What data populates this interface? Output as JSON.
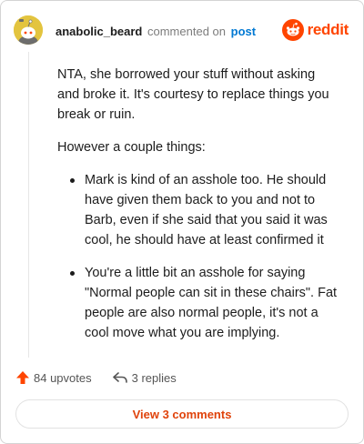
{
  "comment": {
    "username": "anabolic_beard",
    "action_text": "commented on",
    "link_text": "post",
    "paragraphs": [
      "NTA, she borrowed your stuff without asking and broke it. It's courtesy to replace things you break or ruin.",
      "However a couple things:"
    ],
    "bullets": [
      "Mark is kind of an asshole too. He should have given them back to you and not to Barb, even if she said that you said it was cool, he should have at least confirmed it",
      "You're a little bit an asshole for saying \"Normal people can sit in these chairs\". Fat people are also normal people, it's not a cool move what you are implying."
    ]
  },
  "brand": {
    "logo_text": "reddit",
    "accent_color": "#ff4500",
    "link_color": "#0079d3"
  },
  "actions": {
    "upvotes": "84 upvotes",
    "replies": "3 replies"
  },
  "footer": {
    "view_comments": "View 3 comments"
  },
  "icons": {
    "avatar": "snoo-avatar-icon",
    "logo": "reddit-snoo-icon",
    "upvote": "upvote-arrow-icon",
    "reply": "reply-arrow-icon"
  }
}
